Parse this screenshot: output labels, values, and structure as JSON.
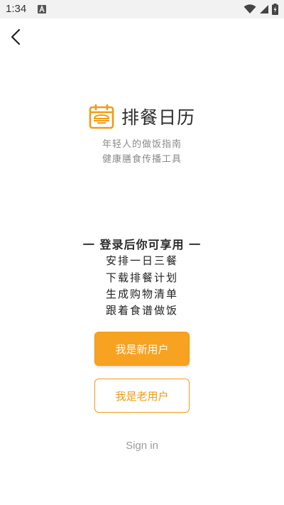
{
  "status_bar": {
    "time": "1:34",
    "icons": [
      "a-notification-icon",
      "wifi-icon",
      "signal-icon",
      "battery-charging-icon"
    ]
  },
  "nav": {
    "back_icon": "chevron-left-icon"
  },
  "app": {
    "name": "排餐日历",
    "logo_icon": "calendar-icon",
    "tagline_line1": "年轻人的做饭指南",
    "tagline_line2": "健康膳食传播工具"
  },
  "login": {
    "heading": "一 登录后你可享用 一",
    "benefits": [
      "安排一日三餐",
      "下载排餐计划",
      "生成购物清单",
      "跟着食谱做饭"
    ]
  },
  "buttons": {
    "new_user": "我是新用户",
    "old_user": "我是老用户",
    "sign_in": "Sign in"
  },
  "colors": {
    "accent": "#f8a221",
    "accent_border": "#f39a12",
    "status_bar_bg": "#f2f2f2",
    "muted_text": "#8a8a8a"
  }
}
